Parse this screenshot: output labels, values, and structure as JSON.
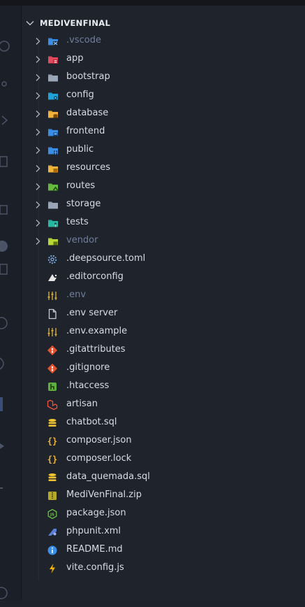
{
  "explorer": {
    "root_label": "MEDIVENFINAL",
    "folders": [
      {
        "label": ".vscode",
        "icon": "vscode-folder-icon",
        "color": "#3a8ee6",
        "dim": true
      },
      {
        "label": "app",
        "icon": "app-folder-icon",
        "color": "#e04b5e",
        "dim": false
      },
      {
        "label": "bootstrap",
        "icon": "folder-icon",
        "color": "#9aa5b6",
        "dim": false
      },
      {
        "label": "config",
        "icon": "config-folder-icon",
        "color": "#1fa3d8",
        "dim": false
      },
      {
        "label": "database",
        "icon": "database-folder-icon",
        "color": "#f2b33d",
        "dim": false
      },
      {
        "label": "frontend",
        "icon": "frontend-folder-icon",
        "color": "#3a8ee6",
        "dim": false
      },
      {
        "label": "public",
        "icon": "public-folder-icon",
        "color": "#3a8ee6",
        "dim": false
      },
      {
        "label": "resources",
        "icon": "resources-folder-icon",
        "color": "#f2b33d",
        "dim": false
      },
      {
        "label": "routes",
        "icon": "routes-folder-icon",
        "color": "#66bb3d",
        "dim": false
      },
      {
        "label": "storage",
        "icon": "folder-icon",
        "color": "#9aa5b6",
        "dim": false
      },
      {
        "label": "tests",
        "icon": "tests-folder-icon",
        "color": "#26b8a3",
        "dim": false
      },
      {
        "label": "vendor",
        "icon": "vendor-folder-icon",
        "color": "#b6d936",
        "dim": true
      }
    ],
    "files": [
      {
        "label": ".deepsource.toml",
        "icon": "gear-file-icon",
        "color": "#7aa7d8",
        "dim": false
      },
      {
        "label": ".editorconfig",
        "icon": "editorconfig-icon",
        "color": "#e6e6e6",
        "dim": false
      },
      {
        "label": ".env",
        "icon": "env-tune-icon",
        "color": "#e0b23a",
        "dim": true
      },
      {
        "label": ".env server",
        "icon": "file-outline-icon",
        "color": "#c6ccd6",
        "dim": false
      },
      {
        "label": ".env.example",
        "icon": "env-tune-icon",
        "color": "#e0b23a",
        "dim": false
      },
      {
        "label": ".gitattributes",
        "icon": "git-icon",
        "color": "#e0532e",
        "dim": false
      },
      {
        "label": ".gitignore",
        "icon": "git-icon",
        "color": "#e0532e",
        "dim": false
      },
      {
        "label": ".htaccess",
        "icon": "htaccess-icon",
        "color": "#5dae3c",
        "dim": false
      },
      {
        "label": "artisan",
        "icon": "laravel-icon",
        "color": "#f05340",
        "dim": false
      },
      {
        "label": "chatbot.sql",
        "icon": "database-icon",
        "color": "#f2c230",
        "dim": false
      },
      {
        "label": "composer.json",
        "icon": "braces-icon",
        "color": "#f2b33d",
        "dim": false
      },
      {
        "label": "composer.lock",
        "icon": "braces-icon",
        "color": "#f2b33d",
        "dim": false
      },
      {
        "label": "data_quemada.sql",
        "icon": "database-icon",
        "color": "#f2c230",
        "dim": false
      },
      {
        "label": "MediVenFinal.zip",
        "icon": "zip-icon",
        "color": "#b4a928",
        "dim": false
      },
      {
        "label": "package.json",
        "icon": "nodejs-icon",
        "color": "#6bbf47",
        "dim": false
      },
      {
        "label": "phpunit.xml",
        "icon": "phpunit-icon",
        "color": "#5a7fd6",
        "dim": false
      },
      {
        "label": "README.md",
        "icon": "info-icon",
        "color": "#3a8ee6",
        "dim": false
      },
      {
        "label": "vite.config.js",
        "icon": "vite-icon",
        "color": "#f5b400",
        "dim": false
      }
    ]
  }
}
